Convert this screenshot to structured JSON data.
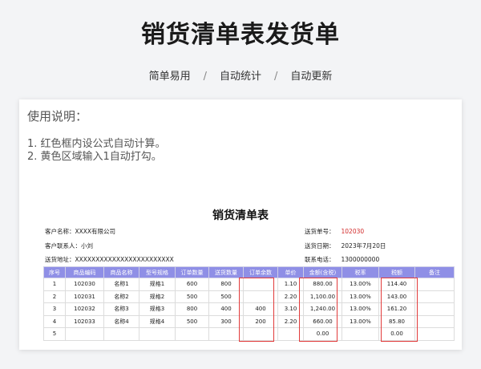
{
  "header": {
    "title": "销货清单表发货单",
    "tags": [
      "简单易用",
      "自动统计",
      "自动更新"
    ],
    "separator": "/"
  },
  "usage": {
    "title": "使用说明：",
    "items": [
      "1. 红色框内设公式自动计算。",
      "2. 黄色区域输入1自动打勾。"
    ]
  },
  "sheet": {
    "title": "销货清单表",
    "customer_name_label": "客户名称：",
    "customer_name_value": "XXXX有限公司",
    "contact_label": "客户联系人：",
    "contact_value": "小刘",
    "address_label": "送货地址：",
    "address_value": "XXXXXXXXXXXXXXXXXXXXXXXX",
    "order_no_label": "送货单号：",
    "order_no_value": "102030",
    "date_label": "送货日期：",
    "date_value": "2023年7月20日",
    "phone_label": "联系电话：",
    "phone_value": "1300000000",
    "columns": [
      "序号",
      "商品编码",
      "商品名称",
      "型号规格",
      "订单数量",
      "送货数量",
      "订单余数",
      "单价",
      "金额(含税)",
      "税率",
      "税额",
      "备注"
    ],
    "rows": [
      [
        "1",
        "102030",
        "名称1",
        "规格1",
        "600",
        "800",
        "",
        "1.10",
        "880.00",
        "13.00%",
        "114.40",
        ""
      ],
      [
        "2",
        "102031",
        "名称2",
        "规格2",
        "500",
        "500",
        "",
        "2.20",
        "1,100.00",
        "13.00%",
        "143.00",
        ""
      ],
      [
        "3",
        "102032",
        "名称3",
        "规格3",
        "800",
        "400",
        "400",
        "3.10",
        "1,240.00",
        "13.00%",
        "161.20",
        ""
      ],
      [
        "4",
        "102033",
        "名称4",
        "规格4",
        "500",
        "300",
        "200",
        "2.20",
        "660.00",
        "13.00%",
        "85.80",
        ""
      ],
      [
        "5",
        "",
        "",
        "",
        "",
        "",
        "",
        "",
        "0.00",
        "",
        "0.00",
        ""
      ]
    ]
  },
  "colors": {
    "header_bg": "#8f8fe6",
    "formula_box": "#e23b3b",
    "order_no": "#d12a2a"
  }
}
